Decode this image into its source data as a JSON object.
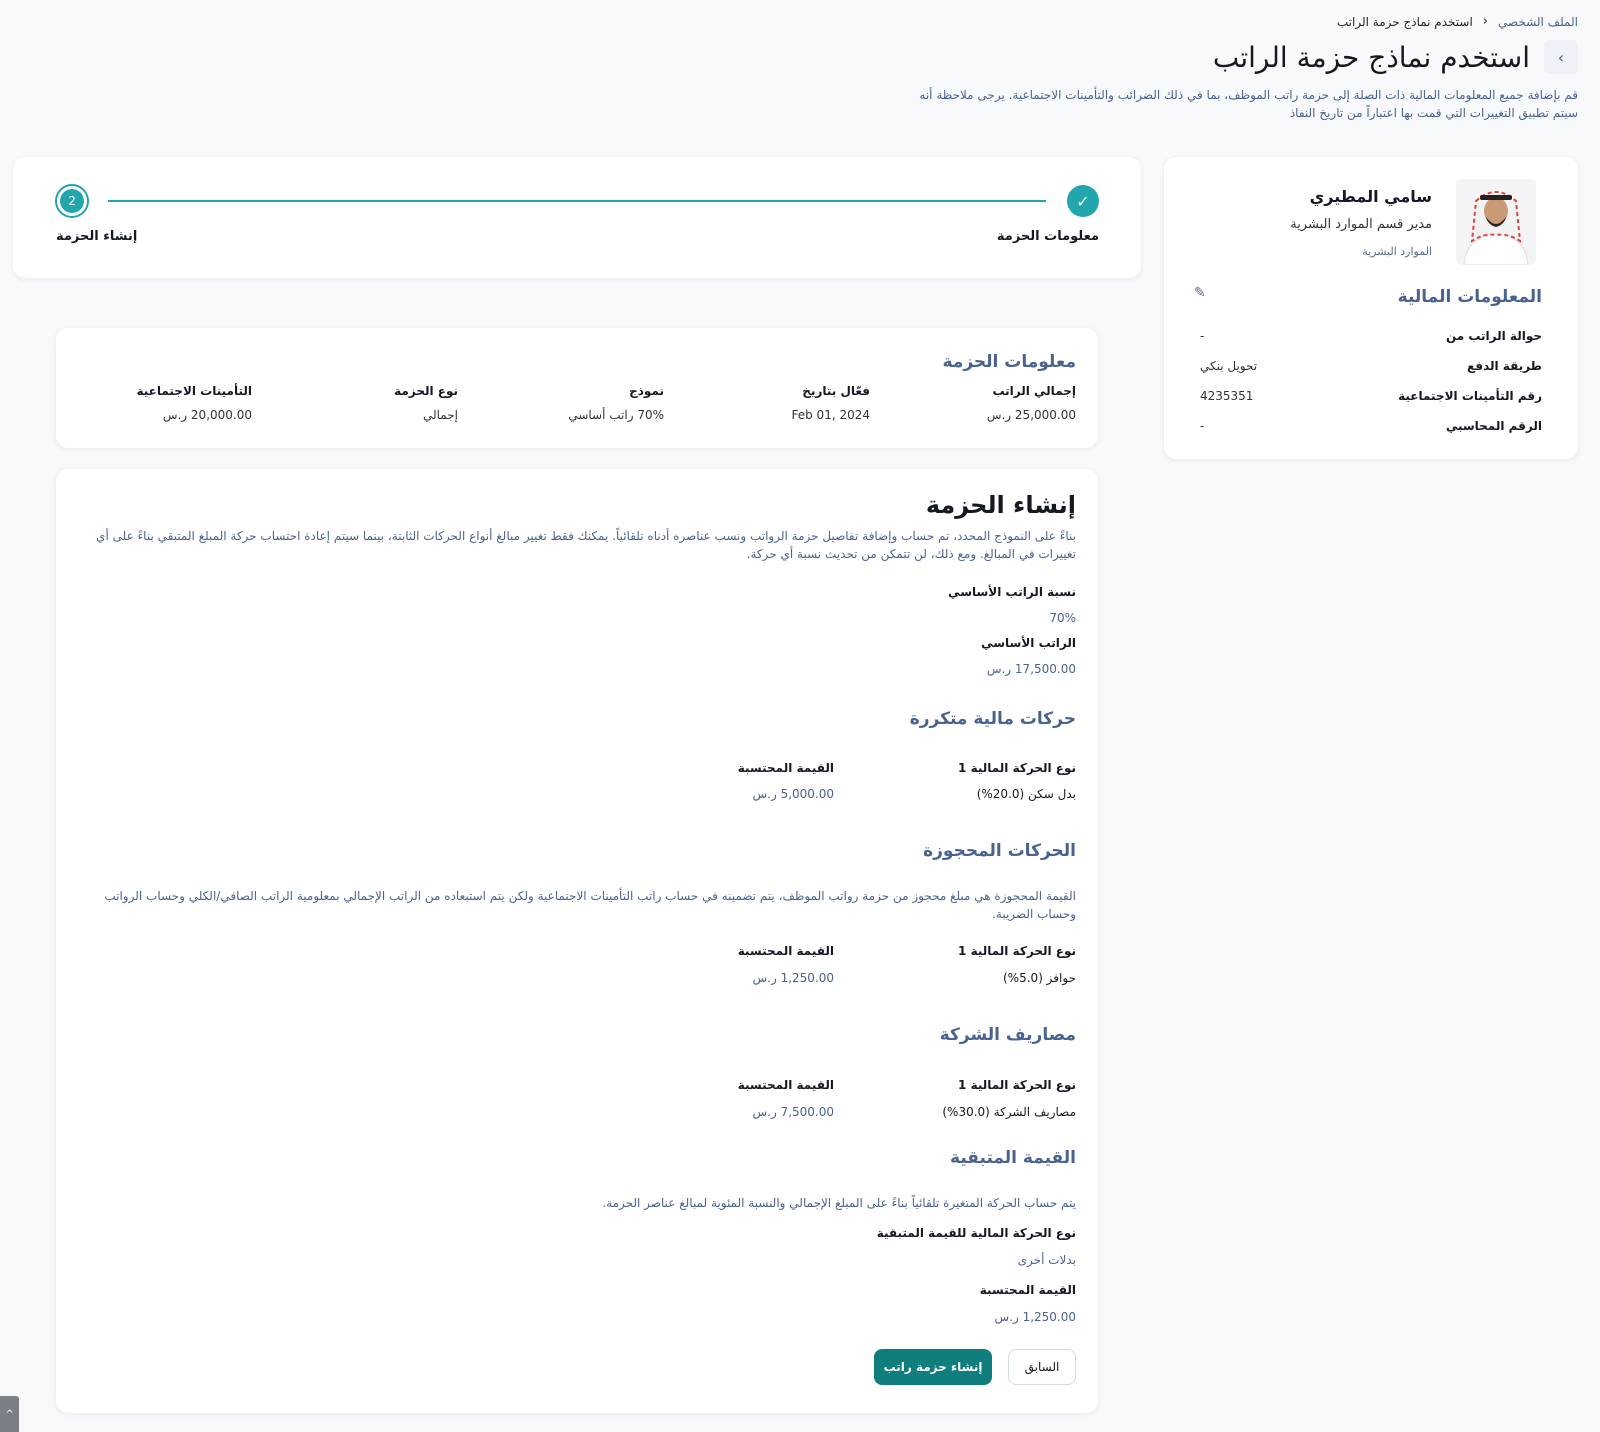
{
  "breadcrumb": {
    "parent": "الملف الشخصي",
    "current": "استخدم نماذج حزمة الراتب"
  },
  "header": {
    "title": "استخدم نماذج حزمة الراتب",
    "description": "قم بإضافة جميع المعلومات المالية ذات الصلة إلى حزمة راتب الموظف، بما في ذلك الضرائب والتأمينات الاجتماعية. يرجى ملاحظة أنه سيتم تطبيق التغييرات التي قمت بها اعتباراً من تاريخ النفاذ"
  },
  "profile": {
    "name": "سامي المطيري",
    "role": "مدير قسم الموارد البشرية",
    "department": "الموارد البشرية",
    "financial_title": "المعلومات المالية",
    "rows": [
      {
        "key": "حوالة الراتب من",
        "value": "-"
      },
      {
        "key": "طريقة الدفع",
        "value": "تحويل بنكي"
      },
      {
        "key": "رقم التأمينات الاجتماعية",
        "value": "4235351"
      },
      {
        "key": "الرقم المحاسبي",
        "value": "-"
      }
    ]
  },
  "stepper": {
    "step1_label": "معلومات الحزمة",
    "step2_label": "إنشاء الحزمة",
    "step2_number": "2",
    "check": "✓"
  },
  "package_info": {
    "title": "معلومات الحزمة",
    "fields": [
      {
        "key": "إجمالي الراتب",
        "value": "25,000.00 ر.س"
      },
      {
        "key": "فعّال بتاريخ",
        "value": "Feb 01, 2024"
      },
      {
        "key": "نموذج",
        "value": "70% راتب أساسي"
      },
      {
        "key": "نوع الحزمة",
        "value": "إجمالي"
      },
      {
        "key": "التأمينات الاجتماعية",
        "value": "20,000.00 ر.س"
      }
    ]
  },
  "create": {
    "title": "إنشاء الحزمة",
    "description": "بناءً على النموذج المحدد، تم حساب وإضافة تفاصيل حزمة الرواتب ونسب عناصره أدناه تلقائياً. يمكنك فقط تغيير مبالغ أنواع الحركات الثابتة، بينما سيتم إعادة احتساب حركة المبلغ المتبقي بناءً على أي تغييرات في المبالغ. ومع ذلك، لن تتمكن من تحديث نسبة أي حركة.",
    "basic_percent_label": "نسبة الراتب الأساسي",
    "basic_percent_value": "70%",
    "basic_salary_label": "الراتب الأساسي",
    "basic_salary_value": "17,500.00 ر.س",
    "recurring": {
      "title": "حركات مالية متكررة",
      "type_label": "نوع الحركة المالية 1",
      "calc_label": "القيمة المحتسبة",
      "type_value": "بدل سكن (20.0%)",
      "calc_value": "5,000.00 ر.س"
    },
    "reserved": {
      "title": "الحركات المحجوزة",
      "description": "القيمة المحجوزة هي مبلغ محجوز من حزمة رواتب الموظف، يتم تضمينه في حساب راتب التأمينات الاجتماعية ولكن يتم استبعاده من الراتب الإجمالي بمعلومية الراتب الصافي/الكلي وحساب الرواتب وحساب الضريبة.",
      "type_label": "نوع الحركة المالية 1",
      "calc_label": "القيمة المحتسبة",
      "type_value": "حوافز (5.0%)",
      "calc_value": "1,250.00 ر.س"
    },
    "company": {
      "title": "مصاريف الشركة",
      "type_label": "نوع الحركة المالية 1",
      "calc_label": "القيمة المحتسبة",
      "type_value": "مصاريف الشركة (30.0%)",
      "calc_value": "7,500.00 ر.س"
    },
    "remaining": {
      "title": "القيمة المتبقية",
      "description": "يتم حساب الحركة المتغيرة تلقائياً بناءً على المبلغ الإجمالي والنسبة المئوية لمبالغ عناصر الحزمة.",
      "type_label": "نوع الحركة المالية للقيمة المتبقية",
      "type_value": "بدلات أخرى",
      "calc_label": "القيمة المحتسبة",
      "calc_value": "1,250.00 ر.س"
    },
    "prev_button": "السابق",
    "create_button": "إنشاء حزمة راتب"
  }
}
